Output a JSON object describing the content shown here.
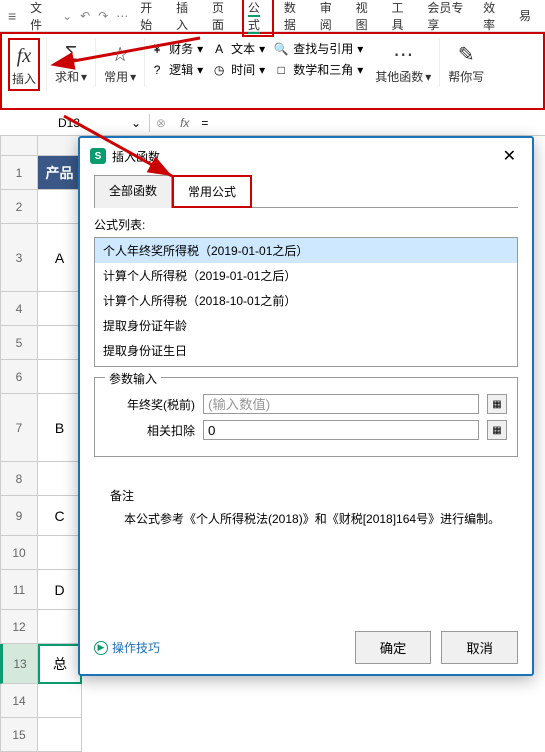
{
  "menubar": {
    "file": "文件",
    "items": [
      "开始",
      "插入",
      "页面",
      "公式",
      "数据",
      "审阅",
      "视图",
      "工具",
      "会员专享",
      "效率",
      "易"
    ],
    "activeIndex": 3
  },
  "ribbon": {
    "insert": {
      "icon": "fx",
      "label": "插入"
    },
    "sum": {
      "label": "求和"
    },
    "common": {
      "label": "常用"
    },
    "groups": {
      "finance": "财务",
      "text": "文本",
      "lookup": "查找与引用",
      "logic": "逻辑",
      "time": "时间",
      "math": "数学和三角",
      "other": "其他函数",
      "help": "帮你写"
    }
  },
  "formulabar": {
    "cellref": "D13",
    "eq": "="
  },
  "sheet": {
    "header": "产品",
    "rows": [
      "A",
      "B",
      "C",
      "D",
      "总"
    ],
    "selectedRow": 13
  },
  "dialog": {
    "title": "插入函数",
    "tabs": {
      "all": "全部函数",
      "common": "常用公式"
    },
    "listLabel": "公式列表:",
    "functions": [
      "个人年终奖所得税（2019-01-01之后）",
      "计算个人所得税（2019-01-01之后）",
      "计算个人所得税（2018-10-01之前）",
      "提取身份证年龄",
      "提取身份证生日"
    ],
    "paramTitle": "参数输入",
    "params": {
      "bonus": {
        "label": "年终奖(税前)",
        "placeholder": "(输入数值)"
      },
      "deduct": {
        "label": "相关扣除",
        "value": "0"
      }
    },
    "remark": {
      "title": "备注",
      "body": "本公式参考《个人所得税法(2018)》和《财税[2018]164号》进行编制。"
    },
    "tips": "操作技巧",
    "ok": "确定",
    "cancel": "取消"
  }
}
